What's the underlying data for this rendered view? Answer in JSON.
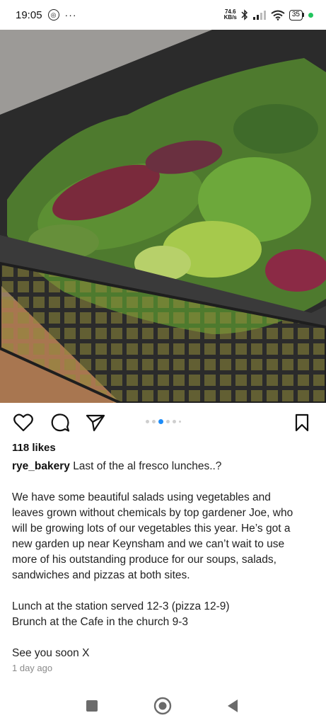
{
  "status_bar": {
    "time": "19:05",
    "net_speed_value": "74.6",
    "net_speed_unit": "KB/s",
    "battery": "35",
    "icons": [
      "notification-circle-icon",
      "more-dots-icon",
      "bluetooth-icon",
      "signal-icon",
      "wifi-icon",
      "battery-icon"
    ]
  },
  "post": {
    "image_alt_icon": "salad-crate-photo",
    "carousel": {
      "total": 5,
      "active_index": 2
    },
    "actions": [
      "like-heart-icon",
      "comment-icon",
      "share-icon",
      "save-bookmark-icon"
    ],
    "likes": "118 likes",
    "username": "rye_bakery",
    "caption_first_line": "Last of the al fresco lunches..?",
    "paragraph1": [
      "We have some beautiful salads using vegetables and",
      "leaves grown without chemicals by top gardener Joe, who",
      "will be growing lots of our vegetables this year. He’s got a",
      "new garden up near Keynsham and we can’t wait to use",
      "more of his outstanding produce for our soups, salads,",
      "sandwiches and pizzas at both sites."
    ],
    "paragraph2": [
      "Lunch at the station served 12-3 (pizza 12-9)",
      "Brunch at the Cafe in the church 9-3"
    ],
    "paragraph3": "See you soon X",
    "time_ago": "1 day ago"
  },
  "navbar": {
    "buttons": [
      "recents-square-icon",
      "home-circle-icon",
      "back-triangle-icon"
    ]
  },
  "colors": {
    "accent": "#1d8cf8",
    "battery_dot": "#22c55e",
    "muted_text": "#8a8a8a"
  }
}
